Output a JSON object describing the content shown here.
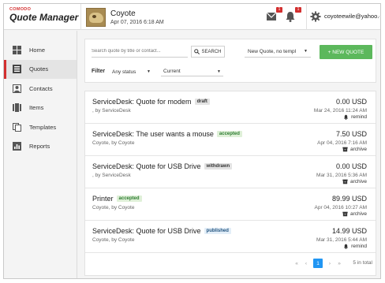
{
  "header": {
    "logo_top": "COMODO",
    "logo_main": "Quote Manager",
    "company_name": "Coyote",
    "company_date": "Apr 07, 2016 6:18 AM",
    "mail_badge": "1",
    "notif_badge": "1",
    "user_email": "coyoteewile@yahoo.con"
  },
  "sidebar": {
    "items": [
      {
        "label": "Home",
        "icon": "home-icon"
      },
      {
        "label": "Quotes",
        "icon": "quotes-icon",
        "active": true
      },
      {
        "label": "Contacts",
        "icon": "contacts-icon"
      },
      {
        "label": "Items",
        "icon": "items-icon"
      },
      {
        "label": "Templates",
        "icon": "templates-icon"
      },
      {
        "label": "Reports",
        "icon": "reports-icon"
      }
    ]
  },
  "toolbar": {
    "search_placeholder": "Search quote by title or contact...",
    "search_button": "SEARCH",
    "new_quote_select": "New Quote, no templ",
    "new_quote_button": "+ NEW QUOTE",
    "filter_label": "Filter",
    "status_filter": "Any status",
    "period_filter": "Current"
  },
  "quotes": [
    {
      "title": "ServiceDesk: Quote for modem",
      "status": "draft",
      "sub": ", by ServiceDesk",
      "amount": "0.00 USD",
      "date": "Mar 24, 2016 11:24 AM",
      "action": "remind"
    },
    {
      "title": "ServiceDesk: The user wants a mouse",
      "status": "accepted",
      "sub": "Coyote, by Coyote",
      "amount": "7.50 USD",
      "date": "Apr 04, 2016 7:16 AM",
      "action": "archive"
    },
    {
      "title": "ServiceDesk: Quote for USB Drive",
      "status": "withdrawn",
      "sub": ", by ServiceDesk",
      "amount": "0.00 USD",
      "date": "Mar 31, 2016 5:36 AM",
      "action": "archive"
    },
    {
      "title": "Printer",
      "status": "accepted",
      "sub": "Coyote, by Coyote",
      "amount": "89.99 USD",
      "date": "Apr 04, 2016 10:27 AM",
      "action": "archive"
    },
    {
      "title": "ServiceDesk: Quote for USB Drive",
      "status": "published",
      "sub": "Coyote, by Coyote",
      "amount": "14.99 USD",
      "date": "Mar 31, 2016 5:44 AM",
      "action": "remind"
    }
  ],
  "pager": {
    "first": "«",
    "prev": "‹",
    "current": "1",
    "next": "›",
    "last": "»",
    "total": "5 in total"
  },
  "colors": {
    "accent": "#d32f2f",
    "new_quote_button": "#5cb85c",
    "pager_current": "#2196f3"
  }
}
